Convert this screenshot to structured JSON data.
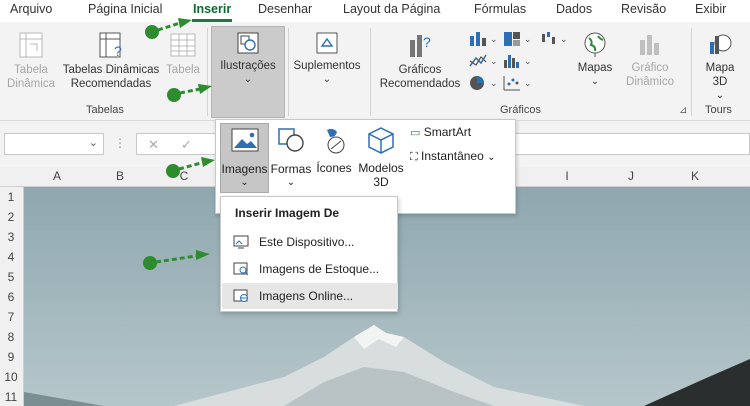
{
  "tabs": [
    "Arquivo",
    "Página Inicial",
    "Inserir",
    "Desenhar",
    "Layout da Página",
    "Fórmulas",
    "Dados",
    "Revisão",
    "Exibir"
  ],
  "ribbon": {
    "tabela_dinamica": "Tabela\nDinâmica",
    "tabelas_dinamicas_recomendadas": "Tabelas Dinâmicas\nRecomendadas",
    "tabela": "Tabela",
    "tabelas_group": "Tabelas",
    "ilustracoes": "Ilustrações",
    "suplementos": "Suplementos",
    "graficos_recomendados": "Gráficos\nRecomendados",
    "mapas": "Mapas",
    "grafico_dinamico": "Gráfico\nDinâmico",
    "graficos_group": "Gráficos",
    "mapa3d": "Mapa\n3D",
    "tours_group": "Tours"
  },
  "formula_bar": {
    "cancel": "✕",
    "confirm": "✓"
  },
  "columns": [
    "A",
    "B",
    "C",
    "I",
    "J",
    "K"
  ],
  "rows": [
    "1",
    "2",
    "3",
    "4",
    "5",
    "6",
    "7",
    "8",
    "9",
    "10",
    "11"
  ],
  "gallery": {
    "imagens": "Imagens",
    "formas": "Formas",
    "icones": "Ícones",
    "modelos": "Modelos\n3D",
    "smartart": "SmartArt",
    "instantaneo": "Instantâneo"
  },
  "submenu": {
    "title": "Inserir Imagem De",
    "items": [
      "Este Dispositivo...",
      "Imagens de Estoque...",
      "Imagens Online..."
    ]
  },
  "colors": {
    "accent": "#1e7a44",
    "annotation": "#2e8b2e"
  }
}
